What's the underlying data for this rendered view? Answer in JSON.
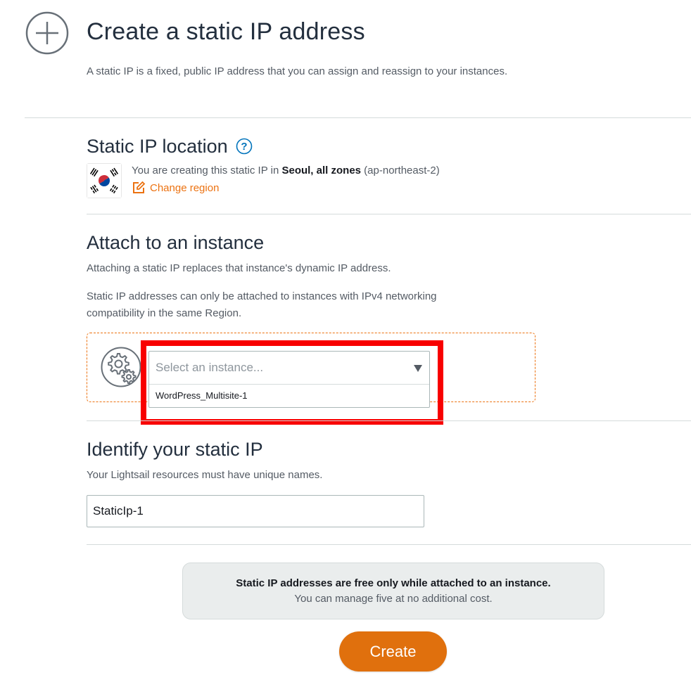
{
  "header": {
    "title": "Create a static IP address",
    "description": "A static IP is a fixed, public IP address that you can assign and reassign to your instances."
  },
  "location": {
    "title": "Static IP location",
    "help_label": "?",
    "text_prefix": "You are creating this static IP in ",
    "region_name": "Seoul, all zones",
    "region_code": "(ap-northeast-2)",
    "change_region_label": "Change region"
  },
  "attach": {
    "title": "Attach to an instance",
    "desc1": "Attaching a static IP replaces that instance's dynamic IP address.",
    "desc2": "Static IP addresses can only be attached to instances with IPv4 networking compatibility in the same Region.",
    "select_placeholder": "Select an instance...",
    "options": [
      "WordPress_Multisite-1"
    ]
  },
  "identify": {
    "title": "Identify your static IP",
    "desc": "Your Lightsail resources must have unique names.",
    "name_value": "StaticIp-1"
  },
  "notice": {
    "strong": "Static IP addresses are free only while attached to an instance.",
    "sub": "You can manage five at no additional cost."
  },
  "actions": {
    "create_label": "Create"
  },
  "colors": {
    "accent": "#ec7211",
    "create_button": "#e0700d",
    "highlight": "#f80000",
    "heading": "#232f3e",
    "muted_text": "#545b64",
    "divider": "#d5dbdb"
  }
}
